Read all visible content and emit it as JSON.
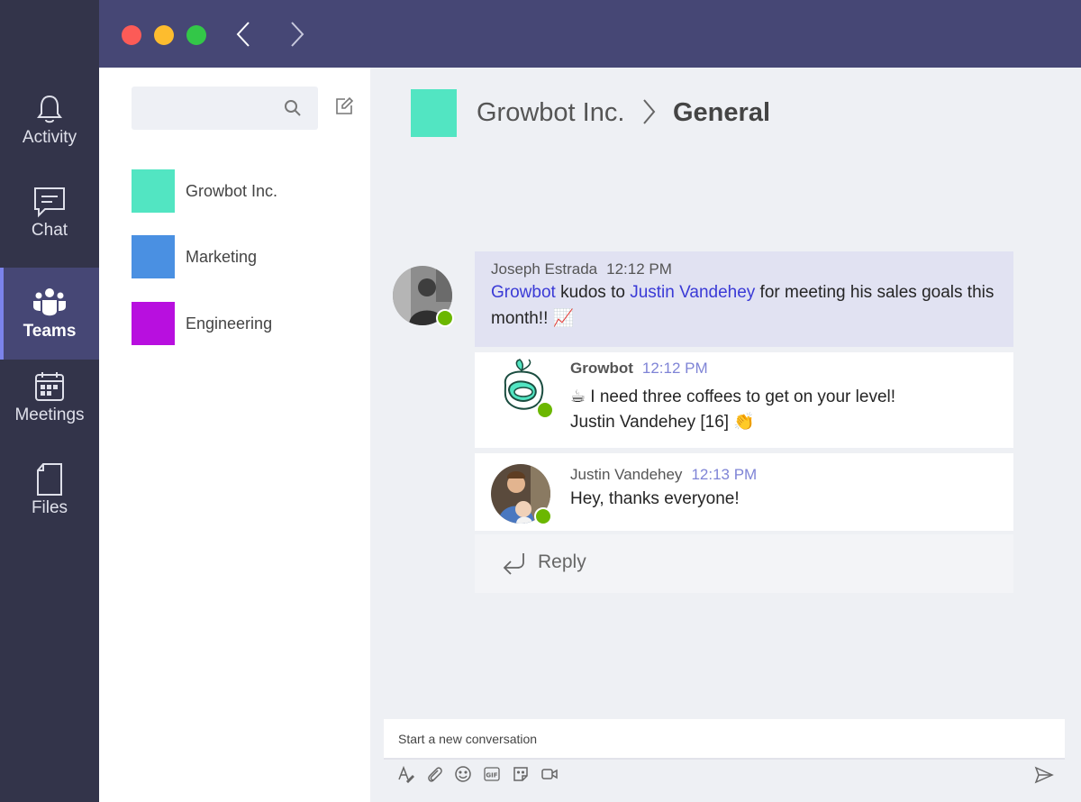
{
  "rail": {
    "items": [
      {
        "label": "Activity",
        "icon": "bell-icon"
      },
      {
        "label": "Chat",
        "icon": "chat-icon"
      },
      {
        "label": "Teams",
        "icon": "teams-icon",
        "active": true
      },
      {
        "label": "Meetings",
        "icon": "calendar-icon"
      },
      {
        "label": "Files",
        "icon": "file-icon"
      }
    ]
  },
  "colors": {
    "rail_bg": "#33344a",
    "titlebar_bg": "#464775",
    "accent": "#7b83eb",
    "mention": "#3a3ad6",
    "presence": "#6bb700"
  },
  "teams": [
    {
      "name": "Growbot Inc.",
      "color": "#52e5c2"
    },
    {
      "name": "Marketing",
      "color": "#4a90e2"
    },
    {
      "name": "Engineering",
      "color": "#b80fdf"
    }
  ],
  "header": {
    "team": "Growbot Inc.",
    "channel": "General"
  },
  "messages": {
    "root": {
      "sender": "Joseph Estrada",
      "time": "12:12 PM",
      "mention1": "Growbot",
      "text1": " kudos to ",
      "mention2": "Justin Vandehey",
      "text2": " for meeting his sales goals this month!! 📈"
    },
    "reply1": {
      "sender": "Growbot",
      "time": "12:12 PM",
      "line1": "☕ I need three coffees to get on your level!",
      "line2": "Justin Vandehey [16] 👏"
    },
    "reply2": {
      "sender": "Justin Vandehey",
      "time": "12:13 PM",
      "text": "Hey, thanks everyone!"
    }
  },
  "reply_label": "Reply",
  "compose": {
    "placeholder": "Start a new conversation"
  }
}
